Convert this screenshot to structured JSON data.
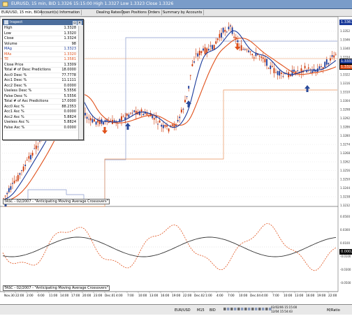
{
  "window": {
    "title": "EURUSD, 15 min, BID 1.3326 15:15:00 High 1.3327 Low 1.3323 Close 1.3326",
    "accent": "#7a9cc9"
  },
  "tabs": [
    {
      "label": "EUR/USD, 15 min, BID"
    },
    {
      "label": "Account(s) Information"
    },
    {
      "label": "Dealing Rates"
    },
    {
      "label": "Open Positions"
    },
    {
      "label": "Orders"
    },
    {
      "label": "Summary by Accounts"
    }
  ],
  "inspect": {
    "title": "Inspect",
    "rows": [
      {
        "k": "High",
        "v": "1.3328",
        "color": "#000"
      },
      {
        "k": "Low",
        "v": "1.3320",
        "color": "#000"
      },
      {
        "k": "Close",
        "v": "1.3324",
        "color": "#000"
      },
      {
        "k": "Volume",
        "v": "98",
        "color": "#000"
      },
      {
        "k": "MAg",
        "v": "1.3323",
        "color": "#1a3a9a"
      },
      {
        "k": "MAs",
        "v": "1.3320",
        "color": "#e0501a"
      },
      {
        "k": "TE",
        "v": "1.3581",
        "color": "#e0501a"
      },
      {
        "k": "Close Price",
        "v": "1.3309",
        "color": "#000"
      },
      {
        "k": "Total # of Desc Predictions",
        "v": "18.0000",
        "color": "#000"
      },
      {
        "k": "Acc0 Desc %",
        "v": "77.7778",
        "color": "#000"
      },
      {
        "k": "Acc1 Desc %",
        "v": "11.1111",
        "color": "#000"
      },
      {
        "k": "Acc2 Desc %",
        "v": "0.0000",
        "color": "#000"
      },
      {
        "k": "Useless Desc %",
        "v": "5.5556",
        "color": "#000"
      },
      {
        "k": "False Desc %",
        "v": "5.5556",
        "color": "#000"
      },
      {
        "k": "Total # of Asc Predictions",
        "v": "17.0000",
        "color": "#000"
      },
      {
        "k": "Acc0 Asc %",
        "v": "88.2353",
        "color": "#000"
      },
      {
        "k": "Acc1 Asc %",
        "v": "0.0000",
        "color": "#000"
      },
      {
        "k": "Acc2 Asc %",
        "v": "5.8824",
        "color": "#000"
      },
      {
        "k": "Useless Asc %",
        "v": "5.8824",
        "color": "#000"
      },
      {
        "k": "False Asc %",
        "v": "0.0000",
        "color": "#000"
      }
    ]
  },
  "price_axis": {
    "labels": [
      "1.3358",
      "1.3352",
      "1.3346",
      "1.3340",
      "1.3334",
      "1.3328",
      "1.3322",
      "1.3316",
      "1.3310",
      "1.3304",
      "1.3298",
      "1.3292",
      "1.3286",
      "1.3280",
      "1.3274",
      "1.3268",
      "1.3262",
      "1.3256",
      "1.3250",
      "1.3244",
      "1.3238",
      "1.3232"
    ],
    "current_price_box": "1.3367",
    "marker_a": "1.3333",
    "marker_b": "1.3326"
  },
  "indicator": {
    "label_top": "TASC - 02/2007 - \"Anticipating Moving Average Crossovers\"",
    "label_bottom": "TASC - 02/2007 - \"Anticipating Moving Average Crossovers\"",
    "axis_labels": [
      "0.0500",
      "0.0300",
      "0.0100",
      "-0.0100",
      "-0.0300",
      "-0.0500"
    ],
    "right_box": "0.00021"
  },
  "time_axis": {
    "labels": [
      "Nov.30",
      "22:00",
      "2:00",
      "6:00",
      "11:00",
      "14:00",
      "17:00",
      "20:00",
      "23:00",
      "Dec.01",
      "4:00",
      "7:00",
      "10:00",
      "13:00",
      "16:00",
      "19:00",
      "22:00",
      "Dec.02",
      "1:00",
      "4:00",
      "7:00",
      "10:00",
      "Dec.04",
      "4:00",
      "7:00",
      "10:00",
      "13:00",
      "16:00",
      "19:00",
      "22:00"
    ],
    "date_box_1": "02/02/06 15:15:00",
    "date_box_2": "12/04 15:54:43"
  },
  "statusbar": {
    "symbol": "EUR/USD",
    "timeframe": "M15",
    "mode": "BID",
    "zoom": "M/Ratio"
  },
  "colors": {
    "candle": "#cc3300",
    "ma_fast": "#1a3a9a",
    "ma_slow": "#e0501a",
    "arrow": "#2a4a9a",
    "envelope": "#8899cc",
    "envelope_orange": "#e8905a"
  }
}
